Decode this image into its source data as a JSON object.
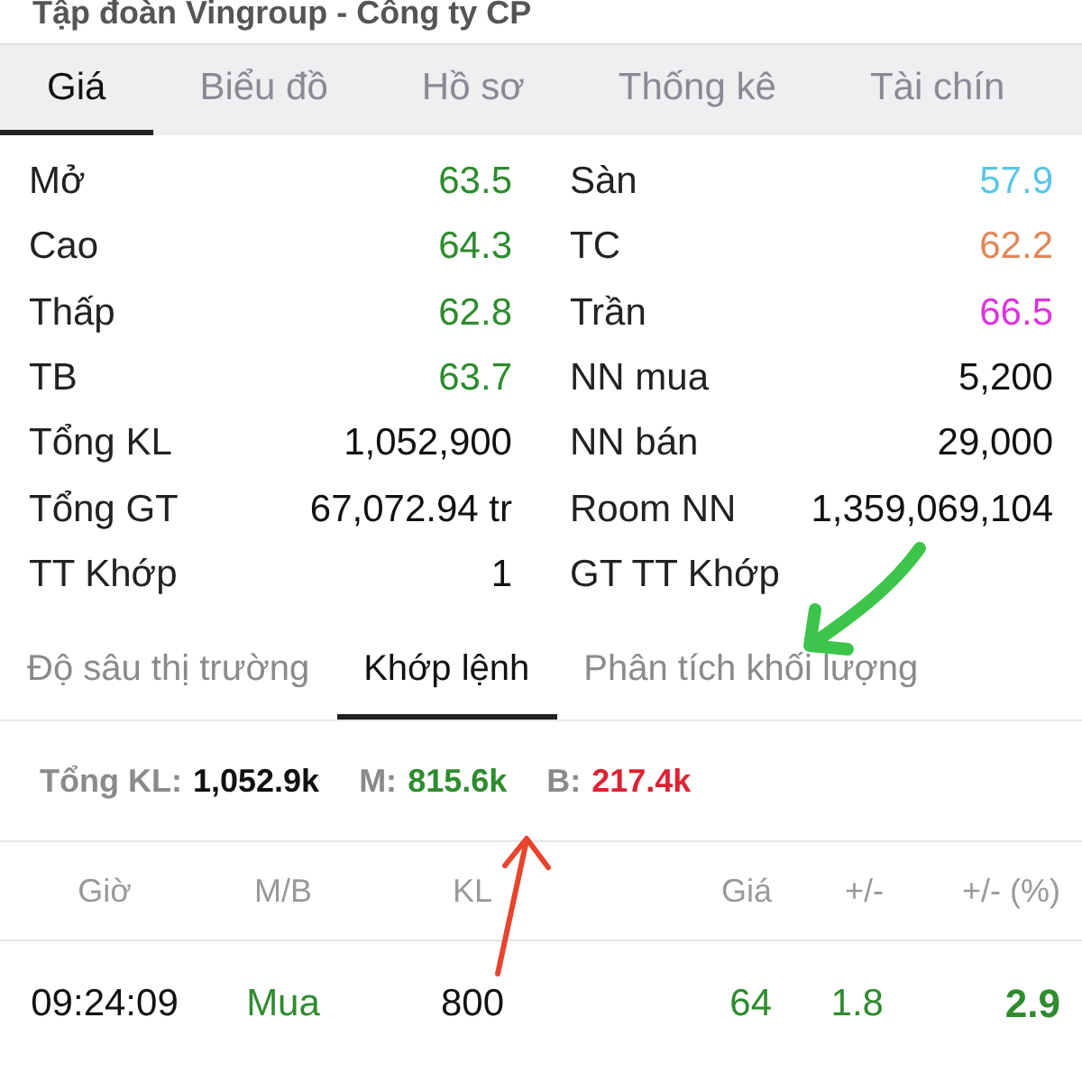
{
  "window": {
    "title": "Tập đoàn Vingroup - Công ty CP"
  },
  "tabs": [
    {
      "label": "Giá",
      "selected": true
    },
    {
      "label": "Biểu đồ",
      "selected": false
    },
    {
      "label": "Hồ sơ",
      "selected": false
    },
    {
      "label": "Thống kê",
      "selected": false
    },
    {
      "label": "Tài chín",
      "selected": false
    }
  ],
  "stats": [
    {
      "label": "Mở",
      "value": "63.5",
      "color": "#2e8b2e"
    },
    {
      "label": "Sàn",
      "value": "57.9",
      "color": "#5cc6e6"
    },
    {
      "label": "Cao",
      "value": "64.3",
      "color": "#2e8b2e"
    },
    {
      "label": "TC",
      "value": "62.2",
      "color": "#e0875a"
    },
    {
      "label": "Thấp",
      "value": "62.8",
      "color": "#2e8b2e"
    },
    {
      "label": "Trần",
      "value": "66.5",
      "color": "#dd33dd"
    },
    {
      "label": "TB",
      "value": "63.7",
      "color": "#2e8b2e"
    },
    {
      "label": "NN mua",
      "value": "5,200",
      "color": "#111111"
    },
    {
      "label": "Tổng KL",
      "value": "1,052,900",
      "color": "#111111"
    },
    {
      "label": "NN bán",
      "value": "29,000",
      "color": "#111111"
    },
    {
      "label": "Tổng GT",
      "value": "67,072.94 tr",
      "color": "#111111"
    },
    {
      "label": "Room NN",
      "value": "1,359,069,104",
      "color": "#111111"
    },
    {
      "label": "TT Khớp",
      "value": "1",
      "color": "#111111"
    },
    {
      "label": "GT TT Khớp"
    }
  ],
  "subtabs": [
    {
      "label": "Độ sâu thị trường",
      "selected": false
    },
    {
      "label": "Khớp lệnh",
      "selected": true
    },
    {
      "label": "Phân tích khối lượng",
      "selected": false
    }
  ],
  "summary": [
    {
      "label": "Tổng KL:",
      "value": "1,052.9k",
      "color": "#111111"
    },
    {
      "label": "M:",
      "value": "815.6k",
      "color": "#2e8b2e"
    },
    {
      "label": "B:",
      "value": "217.4k",
      "color": "#dd2233"
    }
  ],
  "table": {
    "columns": [
      "Giờ",
      "M/B",
      "KL",
      "Giá",
      "+/-",
      "+/- (%)"
    ],
    "rows": [
      [
        {
          "text": "09:24:09",
          "color": "#111111"
        },
        {
          "text": "Mua",
          "color": "#2e8b2e"
        },
        {
          "text": "800",
          "color": "#111111"
        },
        {
          "text": "64",
          "color": "#2e8b2e"
        },
        {
          "text": "1.8",
          "color": "#2e8b2e"
        },
        {
          "text": "2.9",
          "color": "#2e8b2e"
        }
      ]
    ]
  },
  "annotations": [
    {
      "color": "#e8452e"
    },
    {
      "color": "#3cc54a"
    }
  ]
}
